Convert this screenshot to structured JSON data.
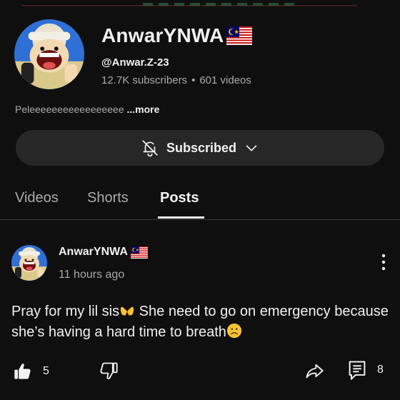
{
  "channel": {
    "name": "AnwarYNWA",
    "flag_icon": "malaysia-flag-icon",
    "handle": "@Anwar.Z-23",
    "subscribers": "12.7K subscribers",
    "separator": "•",
    "videos": "601 videos",
    "description": "Peleeeeeeeeeeeeeeeee",
    "more_label": "...more"
  },
  "subscribe": {
    "label": "Subscribed",
    "bell_icon": "bell-off-icon",
    "chevron_icon": "chevron-down-icon",
    "background": "#272727"
  },
  "tabs": [
    {
      "label": "Videos",
      "active": false
    },
    {
      "label": "Shorts",
      "active": false
    },
    {
      "label": "Posts",
      "active": true
    }
  ],
  "post": {
    "author": "AnwarYNWA",
    "time": "11 hours ago",
    "text_part1": "Pray for my lil sis",
    "text_emoji1": "palms-up-together-emoji",
    "text_part2": " She need to go on emergency because she’s having a hard time to breath",
    "text_emoji2": "slightly-frowning-face-emoji",
    "likes": "5",
    "comments": "8"
  },
  "colors": {
    "background": "#0f0f0f",
    "text_primary": "#f1f1f1",
    "text_secondary": "#aaaaaa",
    "button": "#272727",
    "divider": "#3a3a3a"
  }
}
